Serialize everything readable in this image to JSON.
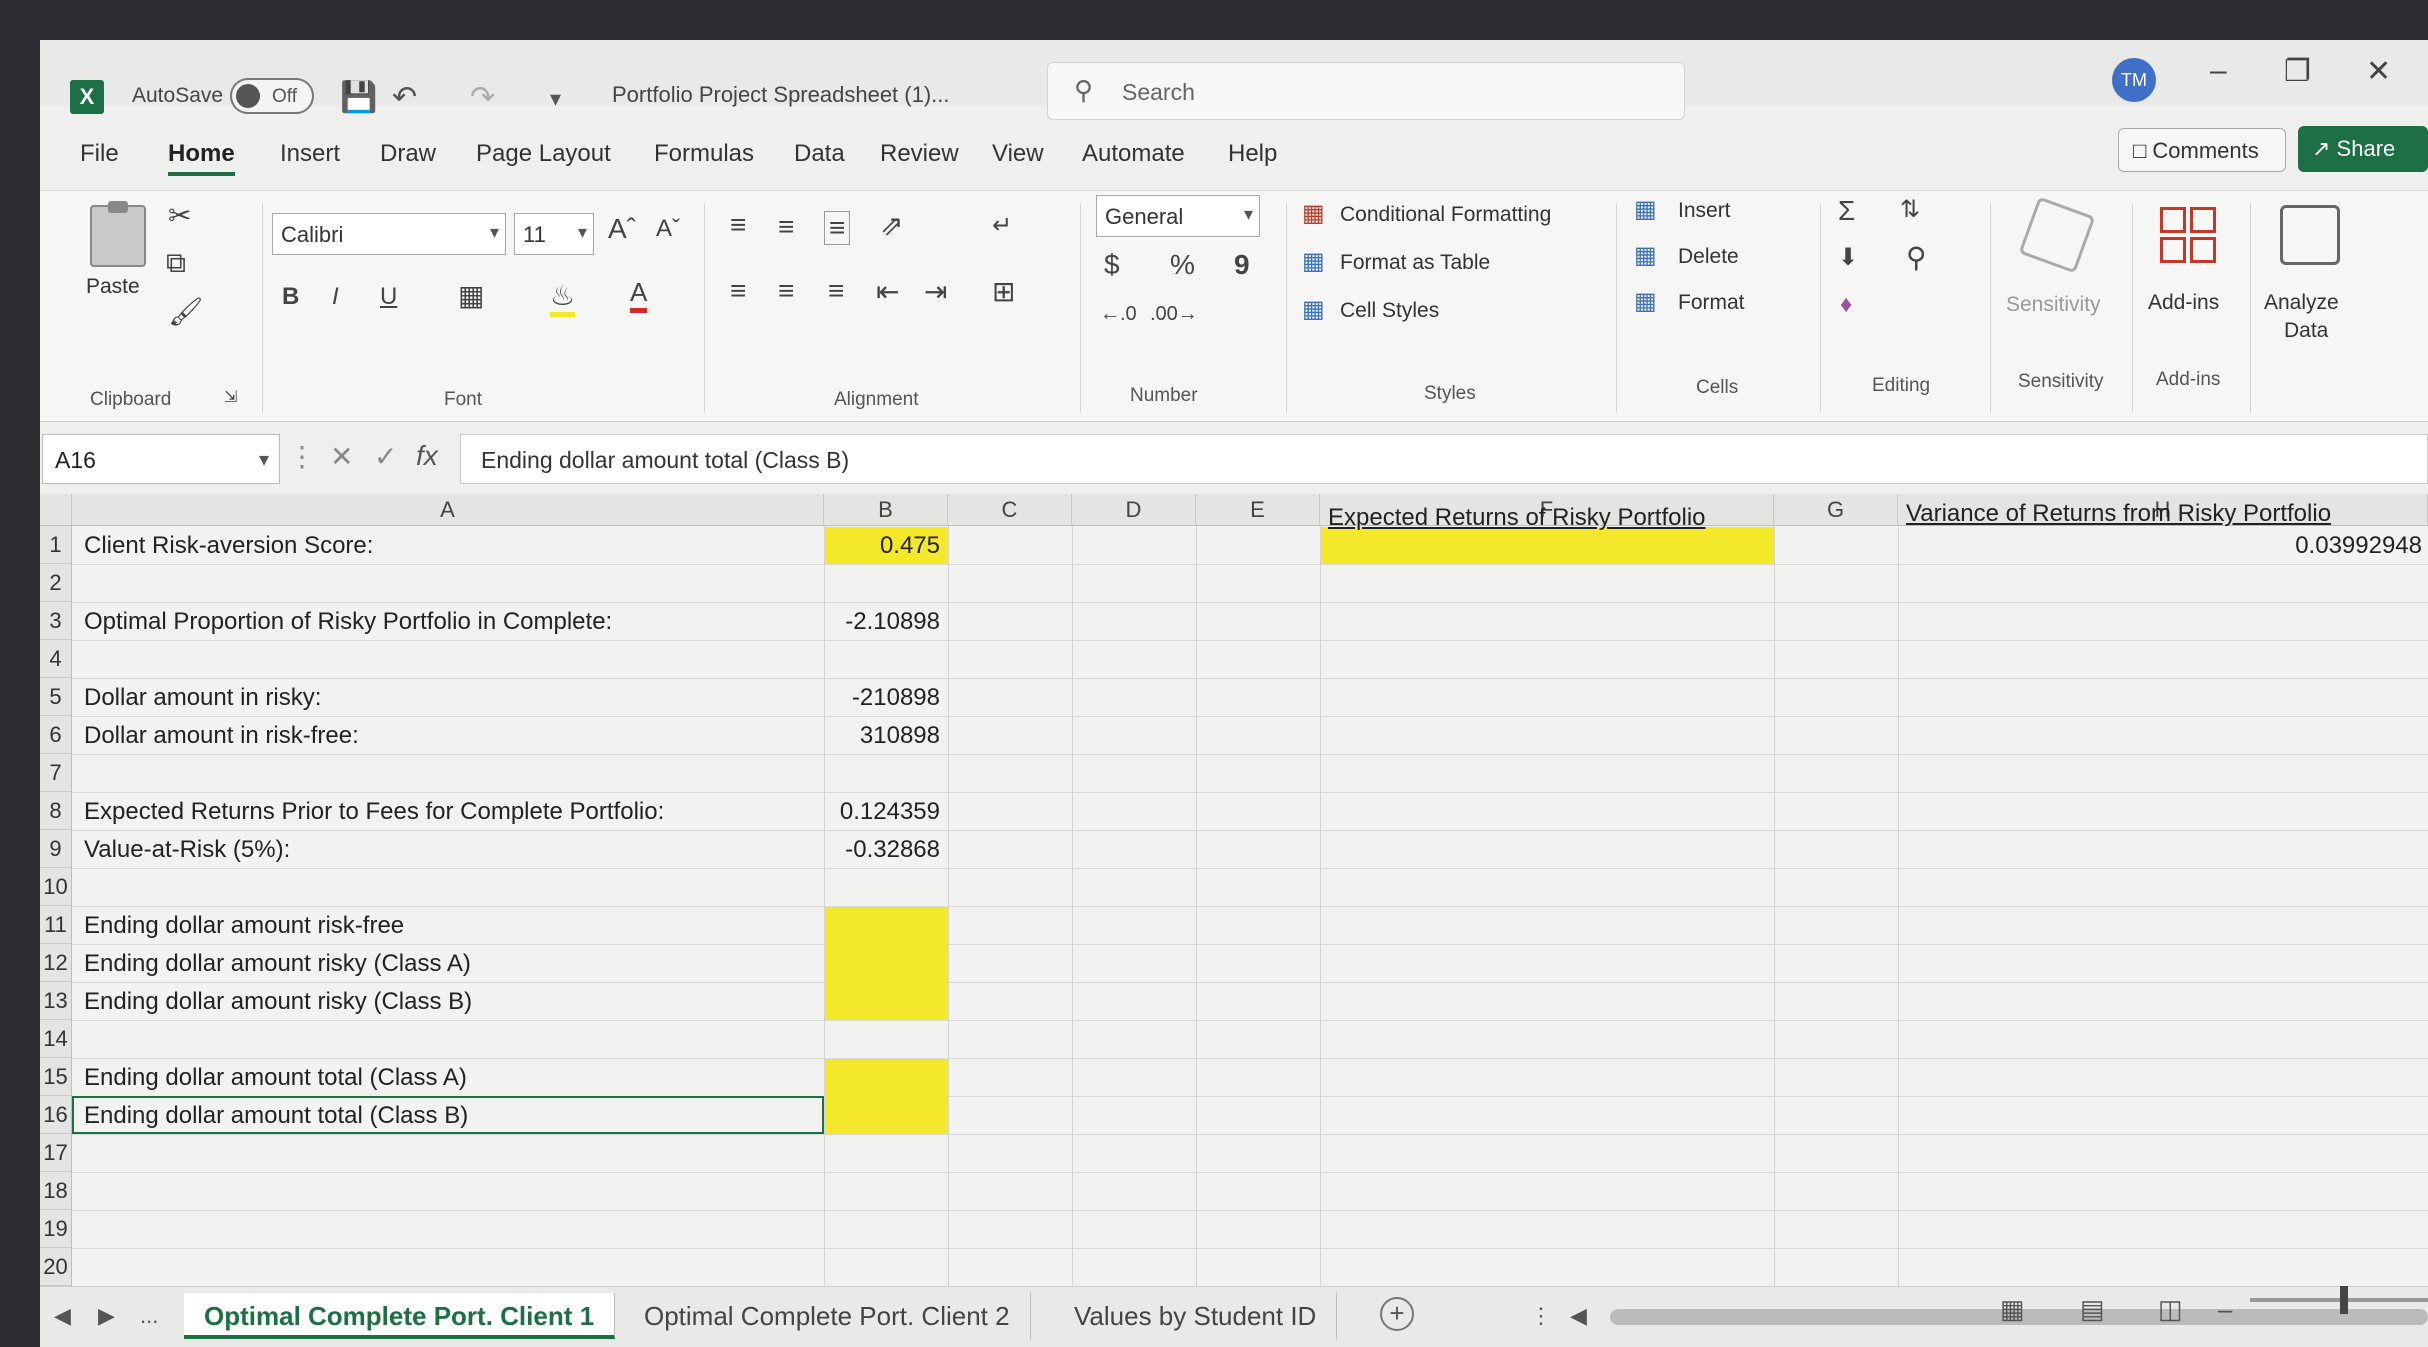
{
  "titlebar": {
    "app_logo": "X",
    "autosave_label": "AutoSave",
    "autosave_state": "Off",
    "doc_title": "Portfolio Project Spreadsheet (1)...",
    "search_placeholder": "Search",
    "avatar_initials": "TM"
  },
  "menu": {
    "tabs": [
      "File",
      "Home",
      "Insert",
      "Draw",
      "Page Layout",
      "Formulas",
      "Data",
      "Review",
      "View",
      "Automate",
      "Help"
    ],
    "active": "Home",
    "comments": "Comments",
    "share": "Share"
  },
  "ribbon": {
    "clipboard": {
      "paste": "Paste",
      "label": "Clipboard"
    },
    "font": {
      "name": "Calibri",
      "size": "11",
      "label": "Font",
      "bold": "B",
      "italic": "I",
      "underline": "U"
    },
    "alignment": {
      "label": "Alignment"
    },
    "number": {
      "format": "General",
      "label": "Number",
      "currency": "$",
      "percent": "%",
      "comma": "9"
    },
    "styles": {
      "conditional": "Conditional Formatting",
      "format_table": "Format as Table",
      "cell_styles": "Cell Styles",
      "label": "Styles"
    },
    "cells": {
      "insert": "Insert",
      "delete": "Delete",
      "format": "Format",
      "label": "Cells"
    },
    "editing": {
      "label": "Editing"
    },
    "sensitivity": {
      "button": "Sensitivity",
      "label": "Sensitivity"
    },
    "addins": {
      "button": "Add-ins",
      "label": "Add-ins"
    },
    "analyze": {
      "line1": "Analyze",
      "line2": "Data"
    }
  },
  "formula_bar": {
    "name_box": "A16",
    "fx": "fx",
    "content": "Ending dollar amount total (Class B)"
  },
  "grid": {
    "columns": [
      "A",
      "B",
      "C",
      "D",
      "E",
      "F",
      "G",
      "H"
    ],
    "rows": [
      "1",
      "2",
      "3",
      "4",
      "5",
      "6",
      "7",
      "8",
      "9",
      "10",
      "11",
      "12",
      "13",
      "14",
      "15",
      "16",
      "17",
      "18",
      "19",
      "20"
    ],
    "a1": "Client Risk-aversion Score:",
    "b1": "0.475",
    "a3": "Optimal Proportion of Risky Portfolio in Complete:",
    "b3": "-2.10898",
    "a5": "Dollar amount in risky:",
    "b5": "-210898",
    "a6": "Dollar amount in risk-free:",
    "b6": "310898",
    "a8": "Expected Returns Prior to Fees for Complete Portfolio:",
    "b8": "0.124359",
    "a9": "Value-at-Risk (5%):",
    "b9": "-0.32868",
    "a11": "Ending dollar amount risk-free",
    "a12": "Ending dollar amount risky (Class A)",
    "a13": "Ending dollar amount risky (Class B)",
    "a15": "Ending dollar amount total (Class A)",
    "a16": "Ending dollar amount total (Class B)",
    "f1": "Expected Returns of Risky Portfolio",
    "h1": "Variance of Returns from Risky Portfolio",
    "h2": "0.03992948",
    "highlight_color": "#f3e82a"
  },
  "sheets": {
    "tabs": [
      "Optimal Complete Port. Client 1",
      "Optimal Complete Port. Client 2",
      "Values by Student ID"
    ],
    "active": "Optimal Complete Port. Client 1",
    "more": "..."
  }
}
